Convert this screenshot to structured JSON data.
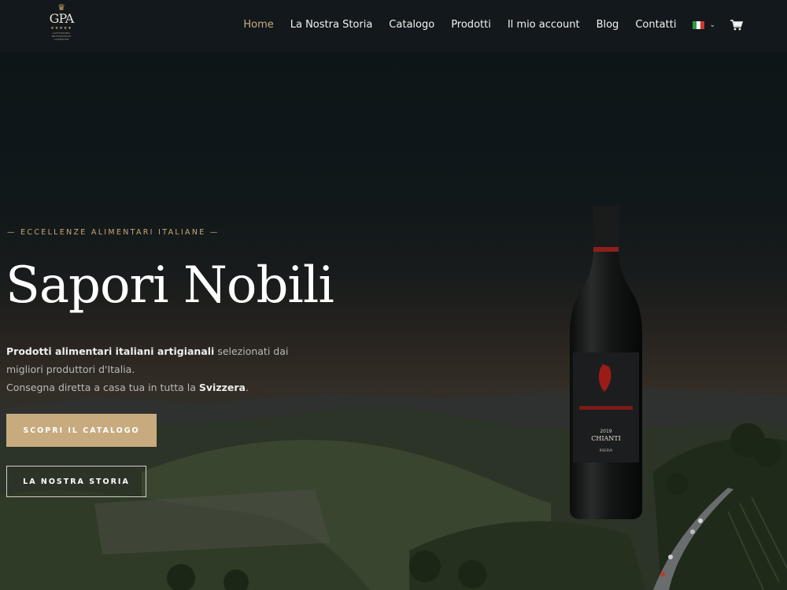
{
  "nav": {
    "logo_text": "GPA",
    "logo_tagline": "GASTRONOMIA PROFESSIONALE ALIMENTARE",
    "items": [
      {
        "label": "Home",
        "active": true
      },
      {
        "label": "La Nostra Storia"
      },
      {
        "label": "Catalogo"
      },
      {
        "label": "Prodotti"
      },
      {
        "label": "Il mio account"
      },
      {
        "label": "Blog"
      },
      {
        "label": "Contatti"
      }
    ],
    "language_icon": "italy-flag-icon",
    "cart_icon": "cart-icon"
  },
  "hero": {
    "eyebrow": "— ECCELLENZE ALIMENTARI ITALIANE —",
    "title": "Sapori Nobili",
    "desc_bold1": "Prodotti alimentari italiani artigianali",
    "desc_text1": " selezionati dai migliori produttori d'Italia.",
    "desc_text2": "Consegna diretta a casa tua in tutta la ",
    "desc_bold2": "Svizzera",
    "desc_end": ".",
    "btn_catalog": "SCOPRI IL CATALOGO",
    "btn_story": "LA NOSTRA STORIA"
  },
  "product": {
    "label_year": "2019",
    "label_name": "CHIANTI",
    "label_sub": "RISERVA"
  },
  "colors": {
    "accent": "#c7ab7f",
    "nav_bg": "#12181b",
    "text": "#ffffff"
  }
}
